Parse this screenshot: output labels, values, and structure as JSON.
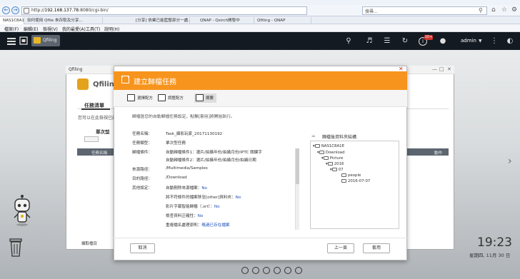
{
  "browser": {
    "url_prefix": "http://",
    "url_host": "192.168.137.78",
    "url_rest": ":8080/cgi-bin/",
    "search_placeholder": "搜尋...",
    "tabs": [
      {
        "label": "NAS1C8A1E",
        "active": true
      },
      {
        "label": "如何使用 Qfile 來存取及分享...",
        "active": false
      },
      {
        "label": "[分享] 依業已能藍整部分一處...",
        "active": false
      },
      {
        "label": "QNAP - Qsirch開發中",
        "active": false
      },
      {
        "label": "Qfiling - QNAP",
        "active": false
      }
    ],
    "menu": [
      "檔案(F)",
      "編輯(E)",
      "檢視(V)",
      "我的最愛(A)",
      "工具(T)",
      "說明(H)"
    ]
  },
  "qts": {
    "app_chip": "Qfiling",
    "user": "admin",
    "notification_badge": "10+"
  },
  "desktop": {
    "time": "19:23",
    "date": "星期四, 11月 30 日"
  },
  "qfiling": {
    "window_title": "Qfiling",
    "app_name": "Qfiling",
    "tab": "任務清單",
    "description": "您可以在此檢視已建立",
    "subheading": "單次型",
    "col_name": "任務名稱",
    "col_action": "動作",
    "footer": "擷取檔目"
  },
  "modal": {
    "title": "建立歸檔任務",
    "steps": [
      "選擇配方",
      "調整配方",
      "摘要"
    ],
    "intro": "歸檔區您的自動歸檔任務設定，點擊[套用]將開始執行。",
    "fields": [
      {
        "label": "任務名稱：",
        "value": "Task_攝影玩家_20171130192"
      },
      {
        "label": "任務類型：",
        "value": "單次型任務"
      },
      {
        "label": "歸檔條件：",
        "value": "自動歸檔條件1：選片/拍攝年份/拍攝月份/IPTC 關鍵字"
      },
      {
        "label": "",
        "value": "自動歸檔條件2：選片/拍攝年份/拍攝月份/拍攝日期"
      },
      {
        "label": "來源路徑：",
        "value": "/Multimedia/Samples"
      },
      {
        "label": "目的路徑：",
        "value": "/Download"
      },
      {
        "label": "其他設定：",
        "value": "自動刪除來源檔案：",
        "value_blue": "No"
      },
      {
        "label": "",
        "value": "將不符條件的檔案移至[other]資料夾：",
        "value_blue": "No"
      },
      {
        "label": "",
        "value": "影片字幕智能歸檔（.srt）：",
        "value_blue": "No"
      },
      {
        "label": "",
        "value": "檢查資料正確性：",
        "value_blue": "No"
      },
      {
        "label": "",
        "value": "重複檔名處理原則：",
        "value_blue": "略過已存在檔案"
      }
    ],
    "preview_title": "歸檔後資料夾結構",
    "tree": [
      "NAS1C8A1E",
      "Download",
      "Picture",
      "2016",
      "07",
      "people",
      "2016-07-07"
    ],
    "cancel": "取消",
    "prev": "上一頁",
    "apply": "套用"
  }
}
